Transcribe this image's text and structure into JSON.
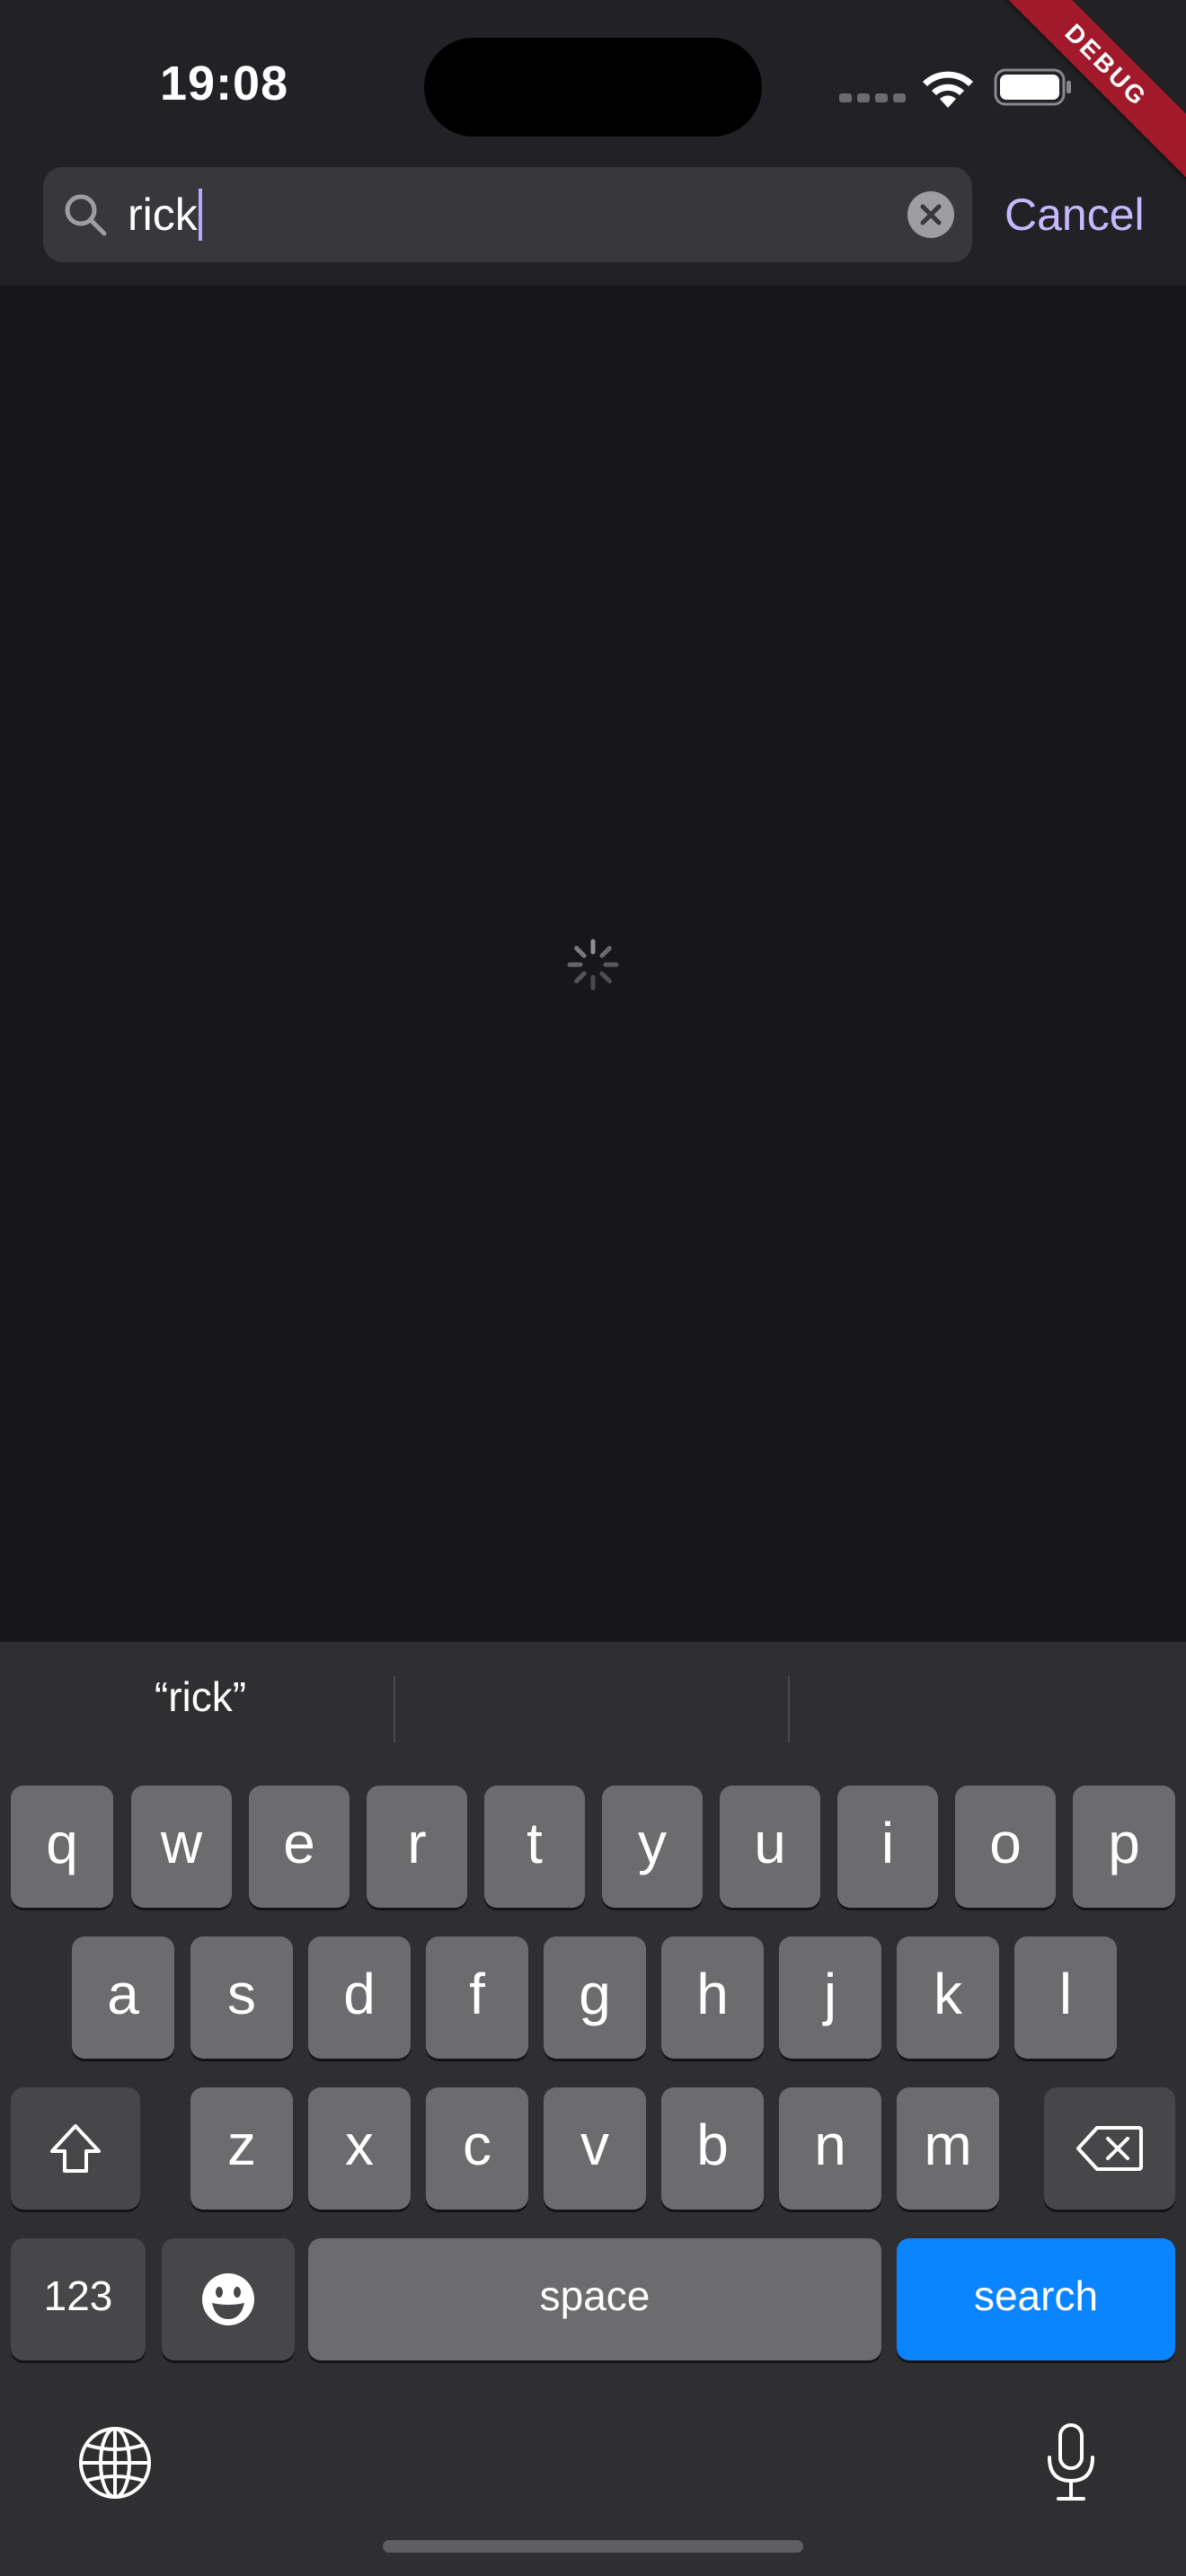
{
  "status_bar": {
    "time": "19:08"
  },
  "debug_banner": "DEBUG",
  "search": {
    "value": "rick",
    "cancel_label": "Cancel"
  },
  "keyboard": {
    "suggestions": [
      "“rick”",
      "",
      ""
    ],
    "row1": [
      "q",
      "w",
      "e",
      "r",
      "t",
      "y",
      "u",
      "i",
      "o",
      "p"
    ],
    "row2": [
      "a",
      "s",
      "d",
      "f",
      "g",
      "h",
      "j",
      "k",
      "l"
    ],
    "row3": [
      "z",
      "x",
      "c",
      "v",
      "b",
      "n",
      "m"
    ],
    "numbers_label": "123",
    "space_label": "space",
    "action_label": "search"
  },
  "colors": {
    "accent": "#c8b9ff",
    "search_key": "#0b84ff",
    "debug_banner": "#a1192a"
  }
}
